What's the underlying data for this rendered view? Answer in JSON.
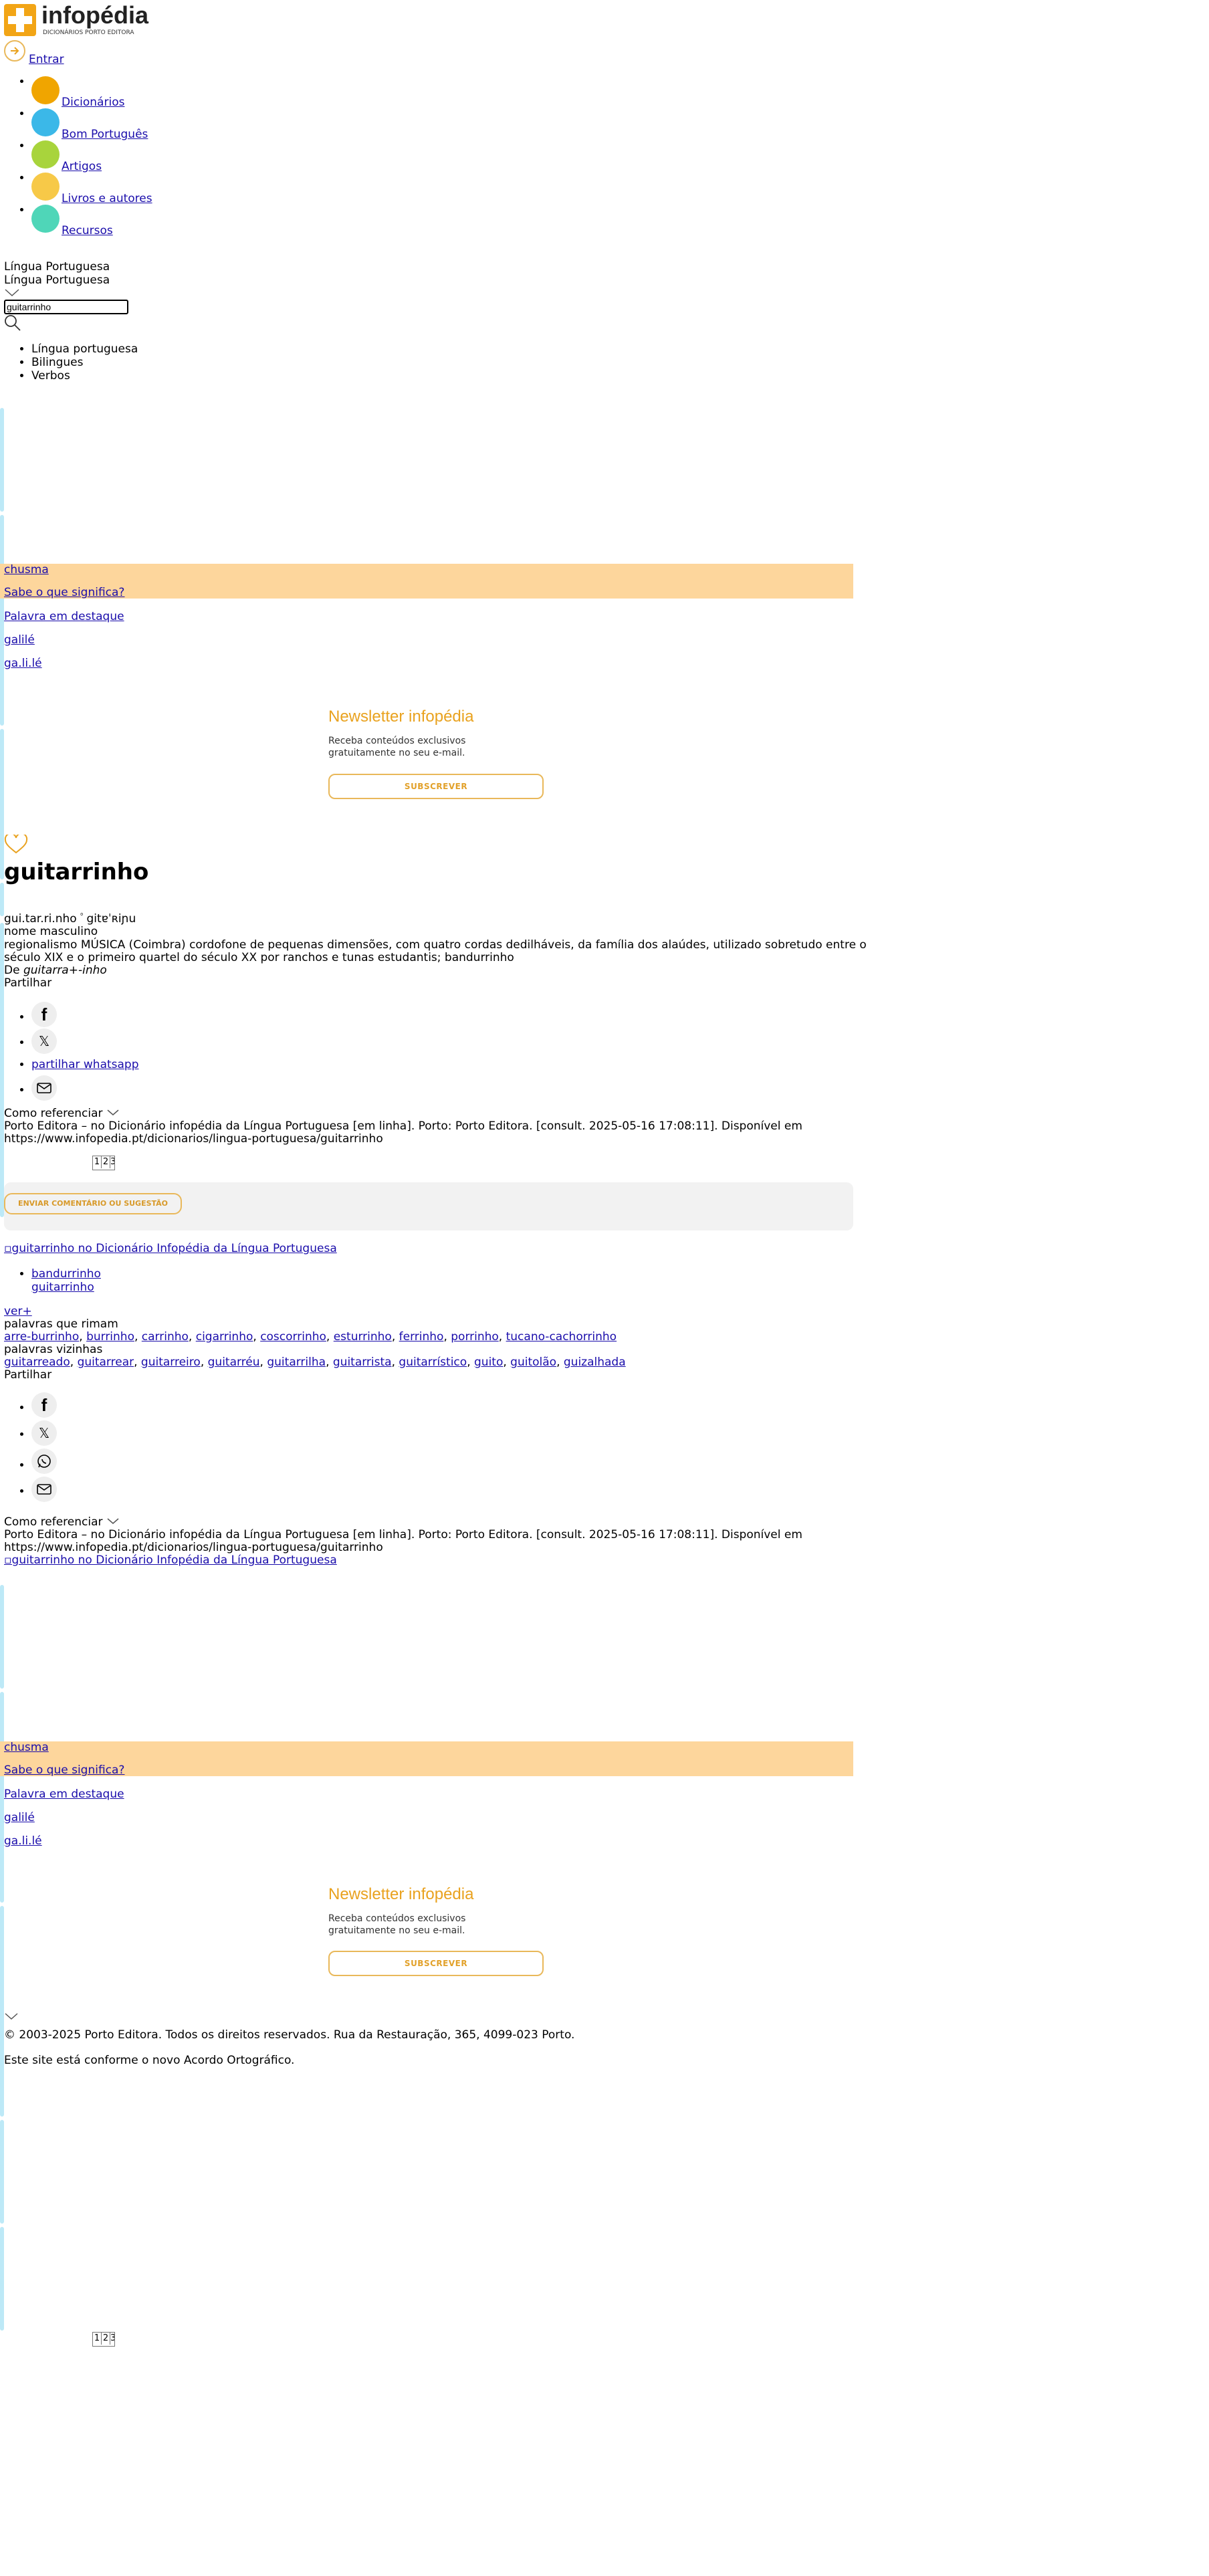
{
  "header": {
    "logo_text": "infopédia",
    "logo_sub": "DICIONÁRIOS PORTO EDITORA",
    "login_label": "Entrar",
    "nav": [
      {
        "label": "Dicionários",
        "color": "#f0a500"
      },
      {
        "label": "Bom Português",
        "color": "#3bb8e8"
      },
      {
        "label": "Artigos",
        "color": "#a8d43c"
      },
      {
        "label": "Livros e autores",
        "color": "#f7c948"
      },
      {
        "label": "Recursos",
        "color": "#4fd6b8"
      }
    ]
  },
  "search": {
    "dict_label": "Língua Portuguesa",
    "dict_selected": "Língua Portuguesa",
    "query": "guitarrinho",
    "options": [
      "Língua portuguesa",
      "Bilingues",
      "Verbos"
    ]
  },
  "promo": {
    "word": "chusma",
    "question": "Sabe o que significa?",
    "featured_label": "Palavra em destaque",
    "featured_word": "galilé",
    "featured_syll": "ga.li.lé"
  },
  "newsletter": {
    "title": "Newsletter infopédia",
    "text1": "Receba conteúdos exclusivos",
    "text2": "gratuitamente no seu e-mail.",
    "button": "SUBSCREVER"
  },
  "entry": {
    "headword": "guitarrinho",
    "syllables": "gui.tar.ri.nho",
    "pron": "gitɐˈʀiɲu",
    "pos": "nome masculino",
    "def_line1": "regionalismo MÚSICA (Coimbra) cordofone de pequenas dimensões, com quatro cordas dedilháveis, da família dos alaúdes, utilizado sobretudo entre o",
    "def_line2": "século XIX e o primeiro quartel do século XX por ranchos e tunas estudantis; bandurrinho",
    "etym_prefix": "De ",
    "etym": "guitarra+-inho",
    "share_label": "Partilhar",
    "whatsapp_alt": "partilhar whatsapp",
    "cite_label": "Como referenciar",
    "cite_line1": "Porto Editora – no Dicionário infopédia da Língua Portuguesa [em linha]. Porto: Porto Editora. [consult. 2025-05-16 17:08:11]. Disponível em",
    "cite_line2": "https://www.infopedia.pt/dicionarios/lingua-portuguesa/guitarrinho",
    "pager": [
      "1",
      "2",
      "3"
    ],
    "feedback_button": "ENVIAR COMENTÁRIO OU SUGESTÃO"
  },
  "related": {
    "image_alt": "guitarrinho no Dicionário Infopédia da Língua Portuguesa",
    "links": [
      "bandurrinho",
      "guitarrinho"
    ],
    "more": "ver+",
    "rhymes_label": "palavras que rimam",
    "rhymes": [
      "arre-burrinho",
      "burrinho",
      "carrinho",
      "cigarrinho",
      "coscorrinho",
      "esturrinho",
      "ferrinho",
      "porrinho",
      "tucano-cachorrinho"
    ],
    "neighbors_label": "palavras vizinhas",
    "neighbors": [
      "guitarreado",
      "guitarrear",
      "guitarreiro",
      "guitarréu",
      "guitarrilha",
      "guitarrista",
      "guitarrístico",
      "guito",
      "guitolão",
      "guizalhada"
    ]
  },
  "footer": {
    "copyright": "© 2003-2025 Porto Editora. Todos os direitos reservados. Rua da Restauração, 365, 4099-023 Porto.",
    "ao": "Este site está conforme o novo Acordo Ortográfico."
  },
  "colors": {
    "accent": "#e9a21f",
    "promo_bg": "#fdd69c",
    "sidebar": "#bde9f7"
  }
}
